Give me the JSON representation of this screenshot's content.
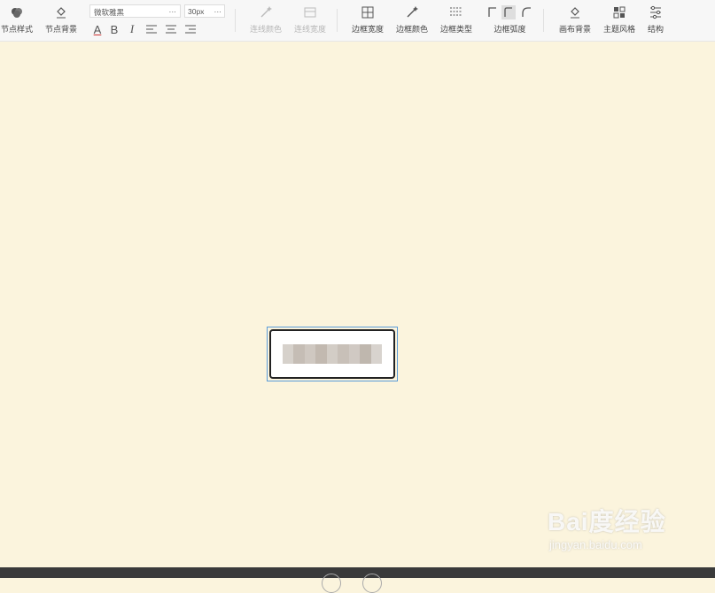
{
  "toolbar": {
    "node_style": "节点样式",
    "node_bg": "节点背景",
    "font_family": "微软雅黑",
    "font_size": "30px",
    "dropdown_more": "···",
    "fmt_color": "A",
    "fmt_bold": "B",
    "fmt_italic": "I",
    "line_color": "连线颜色",
    "line_width": "连线宽度",
    "border_width": "边框宽度",
    "border_color": "边框颜色",
    "border_type": "边框类型",
    "border_radius": "边框弧度",
    "canvas_bg": "画布背景",
    "theme": "主题风格",
    "structure": "结构"
  },
  "watermark": {
    "brand": "Bai度经验",
    "url": "jingyan.baidu.com"
  }
}
